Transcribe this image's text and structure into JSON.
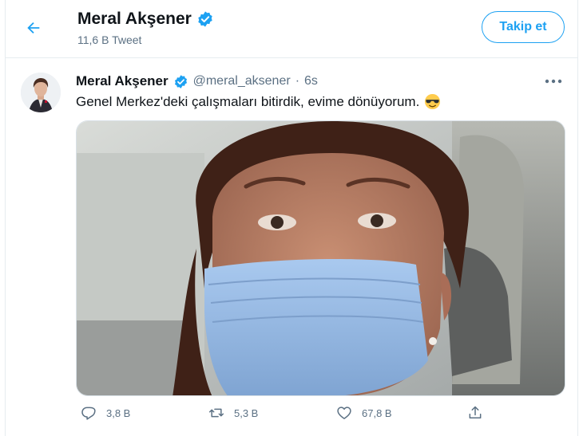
{
  "header": {
    "back_icon": "arrow-left-icon",
    "name": "Meral Akşener",
    "tweet_count": "11,6 B Tweet",
    "follow_label": "Takip et"
  },
  "tweet": {
    "name": "Meral Akşener",
    "handle": "@meral_aksener",
    "separator": "·",
    "time": "6s",
    "text": "Genel Merkez'deki çalışmaları bitirdik, evime dönüyorum.",
    "emoji": "smiling-face-with-sunglasses",
    "media_alt": "selfie-with-face-mask-in-car",
    "actions": {
      "reply_count": "3,8 B",
      "retweet_count": "5,3 B",
      "like_count": "67,8 B"
    }
  },
  "colors": {
    "accent": "#1da1f2",
    "verified": "#1da1f2",
    "muted_text": "#5b7083",
    "border": "#e6ecf0"
  }
}
